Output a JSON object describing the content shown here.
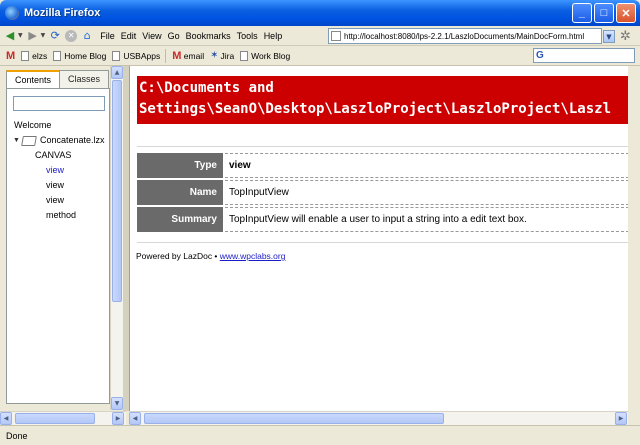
{
  "window": {
    "title": "Mozilla Firefox"
  },
  "menu": [
    "File",
    "Edit",
    "View",
    "Go",
    "Bookmarks",
    "Tools",
    "Help"
  ],
  "address": {
    "url": "http://localhost:8080/lps-2.2.1/LaszloDocuments/MainDocForm.html"
  },
  "bookmarks": [
    "elzs",
    "Home Blog",
    "USBApps",
    "email",
    "Jira",
    "Work Blog"
  ],
  "sidebar": {
    "tabs": [
      "Contents",
      "Classes"
    ],
    "tree": {
      "welcome": "Welcome",
      "file": "Concatenate.lzx",
      "canvas": "CANVAS",
      "children": [
        "view",
        "view",
        "view",
        "method"
      ]
    }
  },
  "doc": {
    "heading_line1": "C:\\Documents and",
    "heading_line2": "Settings\\SeanO\\Desktop\\LaszloProject\\LaszloProject\\Laszl",
    "properties": [
      {
        "key": "Type",
        "value": "view"
      },
      {
        "key": "Name",
        "value": "TopInputView"
      },
      {
        "key": "Summary",
        "value": "TopInputView will enable a user to input a string into a edit text box."
      }
    ],
    "powered_by": "Powered by LazDoc •",
    "powered_link": "www.wpclabs.org"
  },
  "status": {
    "text": "Done"
  },
  "colors": {
    "banner": "#cc0000",
    "prop_key_bg": "#6a6a6a",
    "link": "#1c1cc8"
  }
}
